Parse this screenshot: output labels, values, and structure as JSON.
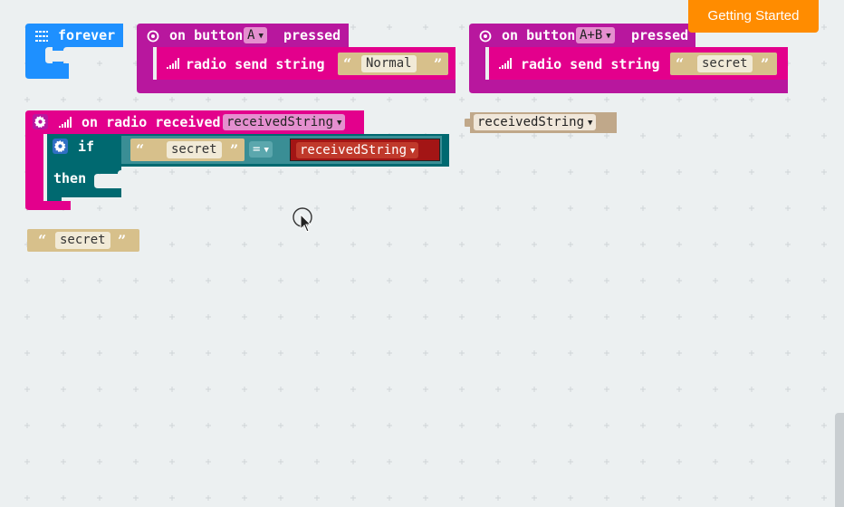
{
  "header": {
    "getting_started": "Getting Started"
  },
  "blocks": {
    "forever": {
      "label": "forever"
    },
    "button_a": {
      "on_label": "on button",
      "button_value": "A",
      "pressed_label": "pressed",
      "send_label": "radio send string",
      "send_value": "Normal"
    },
    "button_ab": {
      "on_label": "on button",
      "button_value": "A+B",
      "pressed_label": "pressed",
      "send_label": "radio send string",
      "send_value": "secret"
    },
    "radio_received": {
      "label": "on radio received",
      "param": "receivedString",
      "if_label": "if",
      "then_label": "then",
      "compare_left": "secret",
      "operator": "=",
      "compare_right": "receivedString"
    },
    "loose_variable": {
      "label": "receivedString"
    },
    "loose_string": {
      "value": "secret"
    }
  },
  "colors": {
    "loops": "#1e90ff",
    "input": "#c2185b",
    "radio": "#e3008c",
    "logic": "#006970",
    "text": "#d7c08b",
    "variable": "#c0a88a",
    "accent": "#ff8c00"
  },
  "icons": {
    "forever": "grid-icon",
    "button_event": "target-icon",
    "radio": "signal-bars-icon",
    "mutator": "gear-icon",
    "cursor": "mouse-pointer-icon"
  }
}
